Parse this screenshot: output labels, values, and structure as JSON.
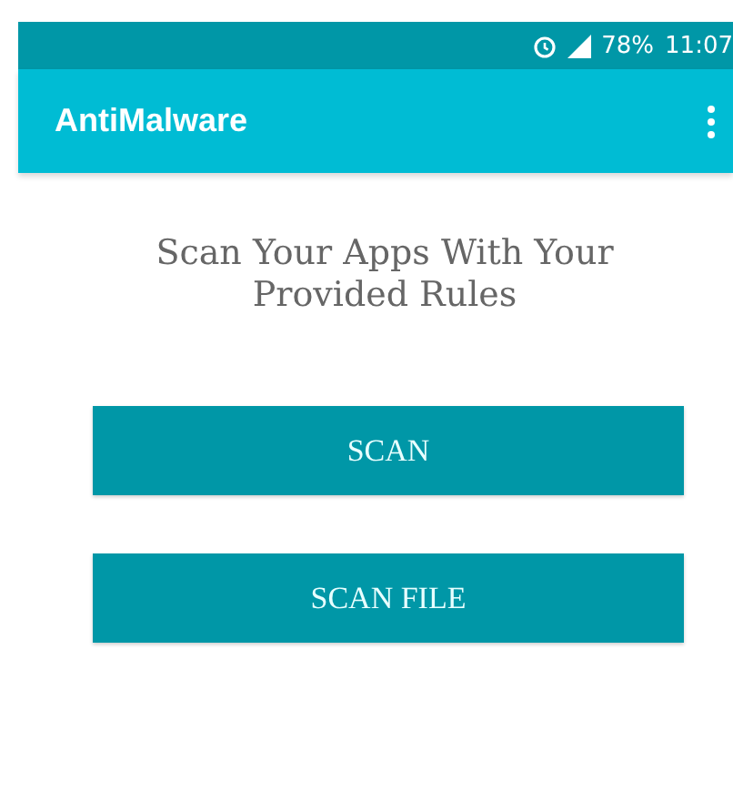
{
  "status_bar": {
    "battery": "78%",
    "time": "11:07"
  },
  "app_bar": {
    "title": "AntiMalware"
  },
  "heading": "Scan Your Apps With Your Provided Rules",
  "buttons": [
    {
      "label": "SCAN"
    },
    {
      "label": "SCAN FILE"
    }
  ]
}
